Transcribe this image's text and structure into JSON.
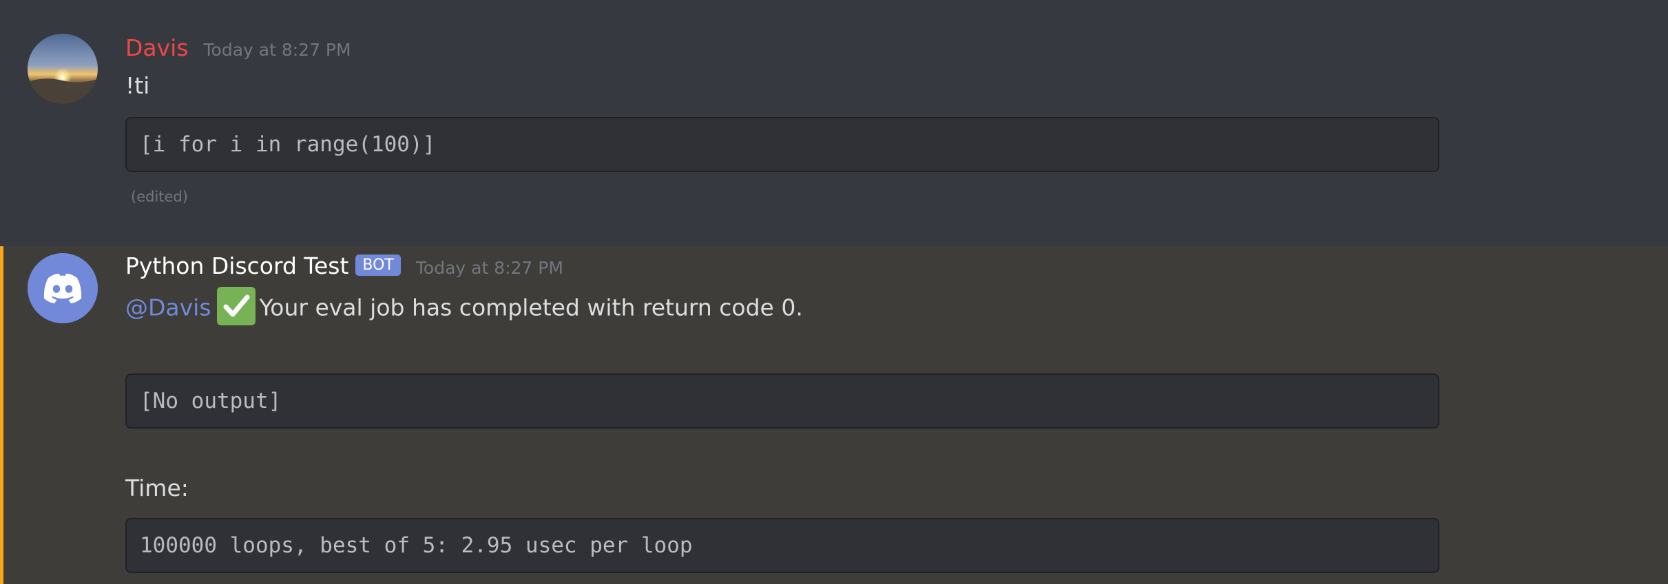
{
  "messages": [
    {
      "author": "Davis",
      "timestamp": "Today at 8:27 PM",
      "text": "!ti",
      "code": "[i for i in range(100)]",
      "edited_label": "(edited)"
    },
    {
      "author": "Python Discord Test",
      "bot_tag": "BOT",
      "timestamp": "Today at 8:27 PM",
      "mention": "@Davis",
      "emoji": "white-check-mark",
      "text": "Your eval job has completed with return code 0.",
      "output_code": "[No output]",
      "time_label": "Time:",
      "time_code": "100000 loops, best of 5: 2.95 usec per loop"
    }
  ],
  "colors": {
    "background": "#36393f",
    "mention_background": "#3e3d3a",
    "mention_bar": "#faa61a",
    "username_davis": "#f04747",
    "blurple": "#7289da",
    "check_green": "#77b255"
  }
}
